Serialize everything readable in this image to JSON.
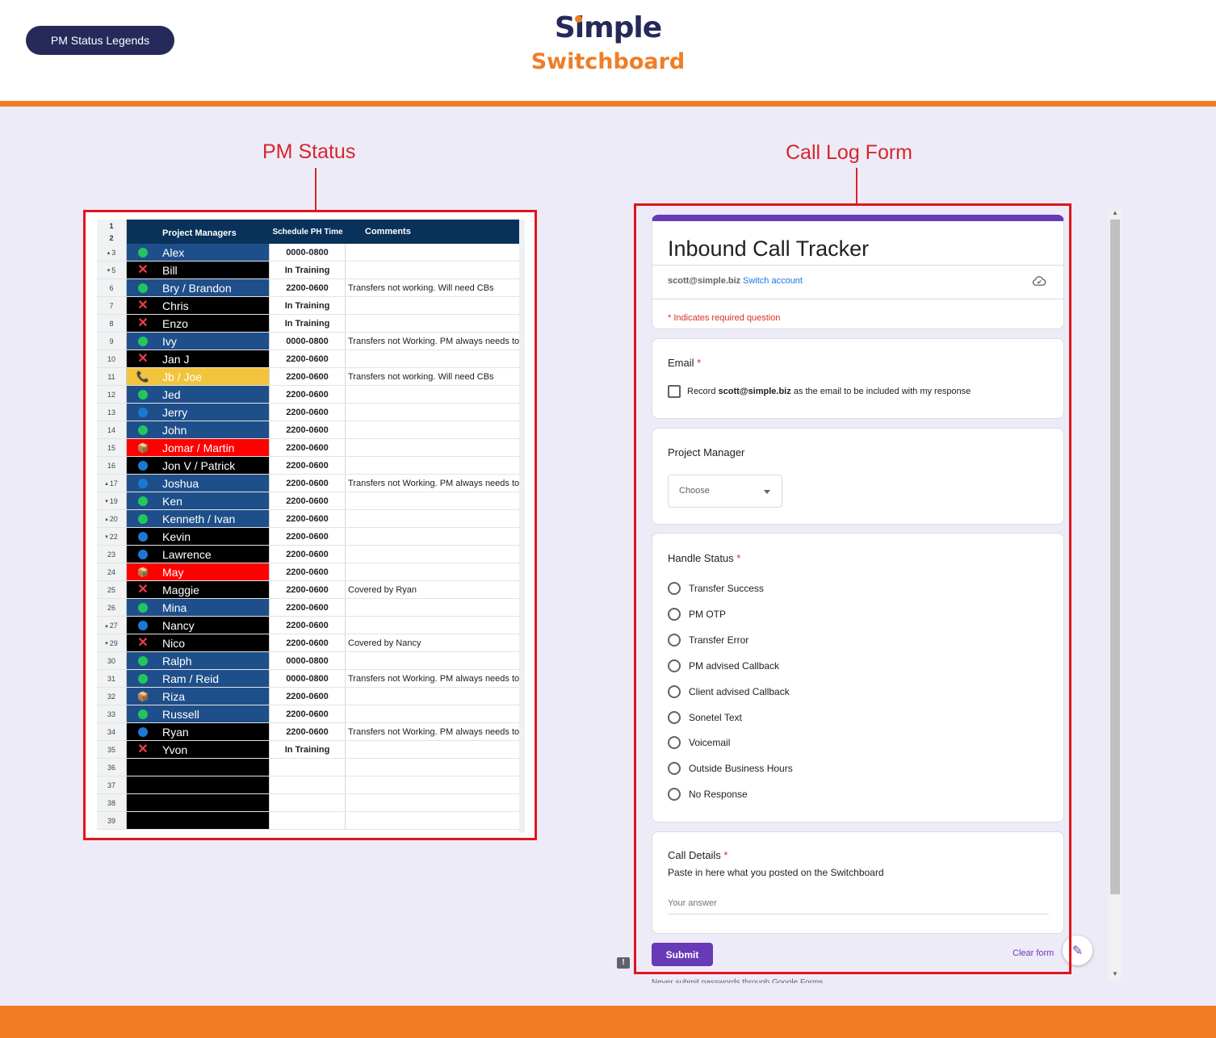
{
  "header": {
    "legend_button": "PM Status Legends",
    "logo_title": "Simple",
    "logo_subtitle": "Switchboard"
  },
  "sections": {
    "pm_status_label": "PM Status",
    "call_log_label": "Call Log Form"
  },
  "colors": {
    "brand_navy": "#252a5a",
    "brand_orange": "#f07d26",
    "highlight_red": "#e0151b",
    "form_purple": "#673ab7"
  },
  "sheet": {
    "header_rows": [
      "1",
      "2"
    ],
    "columns": {
      "name": "Project Managers",
      "schedule": "Schedule PH Time",
      "comments": "Comments"
    },
    "rows": [
      {
        "n": "3",
        "name": "Alex",
        "schedule": "0000-0800",
        "comment": "",
        "status": "green-dot",
        "bg": "blue",
        "marker": "up"
      },
      {
        "n": "5",
        "name": "Bill",
        "schedule": "In Training",
        "comment": "",
        "status": "x-mark",
        "bg": "black",
        "marker": "down"
      },
      {
        "n": "6",
        "name": "Bry / Brandon",
        "schedule": "2200-0600",
        "comment": "Transfers not working. Will need CBs",
        "status": "green-dot",
        "bg": "blue",
        "marker": ""
      },
      {
        "n": "7",
        "name": "Chris",
        "schedule": "In Training",
        "comment": "",
        "status": "x-mark",
        "bg": "black",
        "marker": ""
      },
      {
        "n": "8",
        "name": "Enzo",
        "schedule": "In Training",
        "comment": "",
        "status": "x-mark",
        "bg": "black",
        "marker": ""
      },
      {
        "n": "9",
        "name": "Ivy",
        "schedule": "0000-0800",
        "comment": "Transfers not Working. PM always needs to C",
        "status": "green-dot",
        "bg": "blue",
        "marker": ""
      },
      {
        "n": "10",
        "name": "Jan J",
        "schedule": "2200-0600",
        "comment": "",
        "status": "x-mark",
        "bg": "black",
        "marker": ""
      },
      {
        "n": "11",
        "name": "Jb / Joe",
        "schedule": "2200-0600",
        "comment": "Transfers not working. Will need CBs",
        "status": "phone",
        "bg": "yellow",
        "marker": ""
      },
      {
        "n": "12",
        "name": "Jed",
        "schedule": "2200-0600",
        "comment": "",
        "status": "green-dot",
        "bg": "blue",
        "marker": ""
      },
      {
        "n": "13",
        "name": "Jerry",
        "schedule": "2200-0600",
        "comment": "",
        "status": "blue-dot",
        "bg": "blue",
        "marker": ""
      },
      {
        "n": "14",
        "name": "John",
        "schedule": "2200-0600",
        "comment": "",
        "status": "green-dot",
        "bg": "blue",
        "marker": ""
      },
      {
        "n": "15",
        "name": "Jomar / Martin",
        "schedule": "2200-0600",
        "comment": "",
        "status": "box",
        "bg": "red",
        "marker": ""
      },
      {
        "n": "16",
        "name": "Jon V / Patrick",
        "schedule": "2200-0600",
        "comment": "",
        "status": "blue-dot",
        "bg": "black",
        "marker": ""
      },
      {
        "n": "17",
        "name": "Joshua",
        "schedule": "2200-0600",
        "comment": "Transfers not Working. PM always needs to C",
        "status": "blue-dot",
        "bg": "blue",
        "marker": "up"
      },
      {
        "n": "19",
        "name": "Ken",
        "schedule": "2200-0600",
        "comment": "",
        "status": "green-dot",
        "bg": "blue",
        "marker": "down"
      },
      {
        "n": "20",
        "name": "Kenneth / Ivan",
        "schedule": "2200-0600",
        "comment": "",
        "status": "green-dot",
        "bg": "blue",
        "marker": "up"
      },
      {
        "n": "22",
        "name": "Kevin",
        "schedule": "2200-0600",
        "comment": "",
        "status": "blue-dot",
        "bg": "black",
        "marker": "down"
      },
      {
        "n": "23",
        "name": "Lawrence",
        "schedule": "2200-0600",
        "comment": "",
        "status": "blue-dot",
        "bg": "black",
        "marker": ""
      },
      {
        "n": "24",
        "name": "May",
        "schedule": "2200-0600",
        "comment": "",
        "status": "box",
        "bg": "red",
        "marker": ""
      },
      {
        "n": "25",
        "name": "Maggie",
        "schedule": "2200-0600",
        "comment": "Covered by Ryan",
        "status": "x-mark",
        "bg": "black",
        "marker": ""
      },
      {
        "n": "26",
        "name": "Mina",
        "schedule": "2200-0600",
        "comment": "",
        "status": "green-dot",
        "bg": "blue",
        "marker": ""
      },
      {
        "n": "27",
        "name": "Nancy",
        "schedule": "2200-0600",
        "comment": "",
        "status": "blue-dot",
        "bg": "black",
        "marker": "up"
      },
      {
        "n": "29",
        "name": "Nico",
        "schedule": "2200-0600",
        "comment": "Covered by Nancy",
        "status": "x-mark",
        "bg": "black",
        "marker": "down"
      },
      {
        "n": "30",
        "name": "Ralph",
        "schedule": "0000-0800",
        "comment": "",
        "status": "green-dot",
        "bg": "blue",
        "marker": ""
      },
      {
        "n": "31",
        "name": "Ram / Reid",
        "schedule": "0000-0800",
        "comment": "Transfers not Working. PM always needs to C",
        "status": "green-dot",
        "bg": "blue",
        "marker": ""
      },
      {
        "n": "32",
        "name": "Riza",
        "schedule": "2200-0600",
        "comment": "",
        "status": "box",
        "bg": "blue",
        "marker": ""
      },
      {
        "n": "33",
        "name": "Russell",
        "schedule": "2200-0600",
        "comment": "",
        "status": "green-dot",
        "bg": "blue",
        "marker": ""
      },
      {
        "n": "34",
        "name": "Ryan",
        "schedule": "2200-0600",
        "comment": "Transfers not Working. PM always needs to C",
        "status": "blue-dot",
        "bg": "black",
        "marker": ""
      },
      {
        "n": "35",
        "name": "Yvon",
        "schedule": "In Training",
        "comment": "",
        "status": "x-mark",
        "bg": "black",
        "marker": ""
      },
      {
        "n": "36",
        "name": "",
        "schedule": "",
        "comment": "",
        "status": "",
        "bg": "empty",
        "marker": ""
      },
      {
        "n": "37",
        "name": "",
        "schedule": "",
        "comment": "",
        "status": "",
        "bg": "empty",
        "marker": ""
      },
      {
        "n": "38",
        "name": "",
        "schedule": "",
        "comment": "",
        "status": "",
        "bg": "empty",
        "marker": ""
      },
      {
        "n": "39",
        "name": "",
        "schedule": "",
        "comment": "",
        "status": "",
        "bg": "empty",
        "marker": ""
      }
    ]
  },
  "form": {
    "title": "Inbound Call Tracker",
    "account_email": "scott@simple.biz",
    "switch_account": "Switch account",
    "required_note": "* Indicates required question",
    "email": {
      "label": "Email",
      "required_mark": "*",
      "record_prefix": "Record",
      "record_email": "scott@simple.biz",
      "record_suffix": "as the email to be included with my response"
    },
    "project_manager": {
      "label": "Project Manager",
      "dropdown_value": "Choose"
    },
    "handle_status": {
      "label": "Handle Status",
      "required_mark": "*",
      "options": [
        "Transfer Success",
        "PM OTP",
        "Transfer Error",
        "PM advised Callback",
        "Client advised Callback",
        "Sonetel Text",
        "Voicemail",
        "Outside Business Hours",
        "No Response"
      ]
    },
    "call_details": {
      "label": "Call Details",
      "required_mark": "*",
      "help": "Paste in here what you posted on the Switchboard",
      "placeholder": "Your answer"
    },
    "submit": "Submit",
    "clear": "Clear form",
    "footer_note": "Never submit passwords through Google Forms."
  }
}
